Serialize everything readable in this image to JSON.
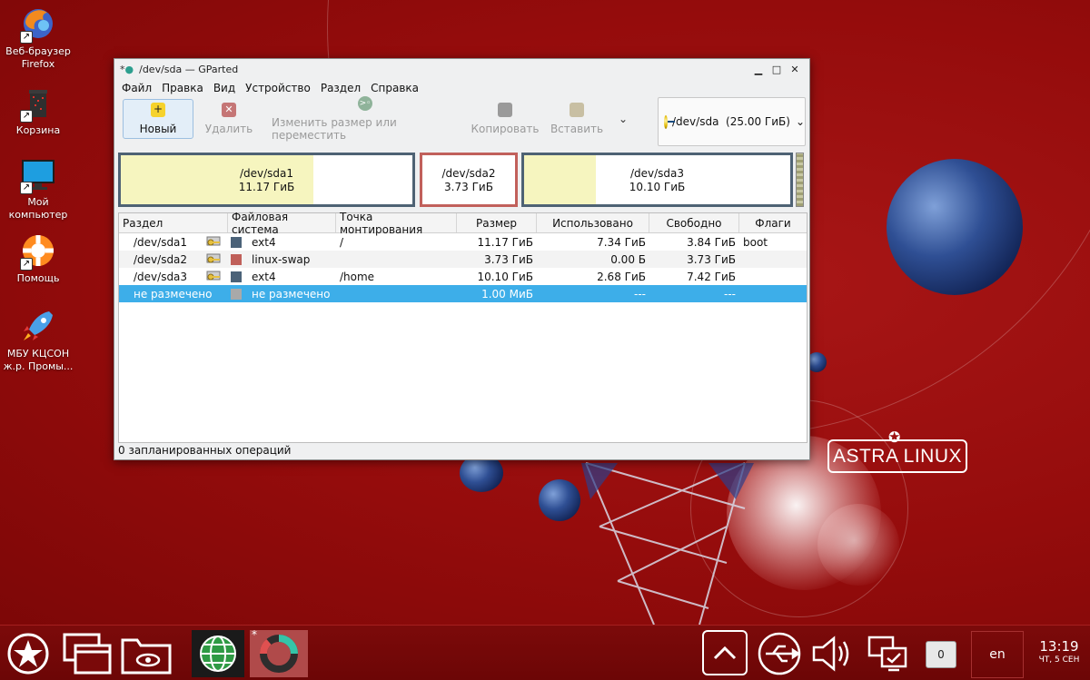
{
  "desktop": {
    "icons": [
      {
        "label": "Веб-браузер Firefox",
        "icon": "firefox-icon"
      },
      {
        "label": "Корзина",
        "icon": "trash-icon"
      },
      {
        "label": "Мой компьютер",
        "icon": "computer-icon"
      },
      {
        "label": "Помощь",
        "icon": "help-icon"
      },
      {
        "label": "МБУ КЦСОН ж.р. Промы...",
        "icon": "rocket-icon"
      }
    ],
    "logo": "ASTRA LINUX"
  },
  "window": {
    "title": "/dev/sda — GParted",
    "menu": [
      "Файл",
      "Правка",
      "Вид",
      "Устройство",
      "Раздел",
      "Справка"
    ],
    "toolbar": {
      "new": "Новый",
      "delete": "Удалить",
      "resize": "Изменить размер или переместить",
      "copy": "Копировать",
      "paste": "Вставить"
    },
    "device_select": "/dev/sda  (25.00 ГиБ)",
    "graph": [
      {
        "name": "/dev/sda1",
        "size": "11.17 ГиБ",
        "used_fraction": 0.66
      },
      {
        "name": "/dev/sda2",
        "size": "3.73 ГиБ",
        "used_fraction": 0
      },
      {
        "name": "/dev/sda3",
        "size": "10.10 ГиБ",
        "used_fraction": 0.27
      }
    ],
    "columns": [
      "Раздел",
      "Файловая система",
      "Точка монтирования",
      "Размер",
      "Использовано",
      "Свободно",
      "Флаги"
    ],
    "rows": [
      {
        "partition": "/dev/sda1",
        "fs": "ext4",
        "fs_color": "#4b6278",
        "mount": "/",
        "size": "11.17 ГиБ",
        "used": "7.34 ГиБ",
        "free": "3.84 ГиБ",
        "flags": "boot"
      },
      {
        "partition": "/dev/sda2",
        "fs": "linux-swap",
        "fs_color": "#c0605a",
        "mount": "",
        "size": "3.73 ГиБ",
        "used": "0.00 Б",
        "free": "3.73 ГиБ",
        "flags": ""
      },
      {
        "partition": "/dev/sda3",
        "fs": "ext4",
        "fs_color": "#4b6278",
        "mount": "/home",
        "size": "10.10 ГиБ",
        "used": "2.68 ГиБ",
        "free": "7.42 ГиБ",
        "flags": ""
      },
      {
        "partition": "не размечено",
        "fs": "не размечено",
        "fs_color": "#a9a9a9",
        "mount": "",
        "size": "1.00 МиБ",
        "used": "---",
        "free": "---",
        "flags": ""
      }
    ],
    "status": "0 запланированных операций"
  },
  "taskbar": {
    "tray_count": "0",
    "lang": "en",
    "time": "13:19",
    "date": "ЧТ, 5 СЕН"
  }
}
